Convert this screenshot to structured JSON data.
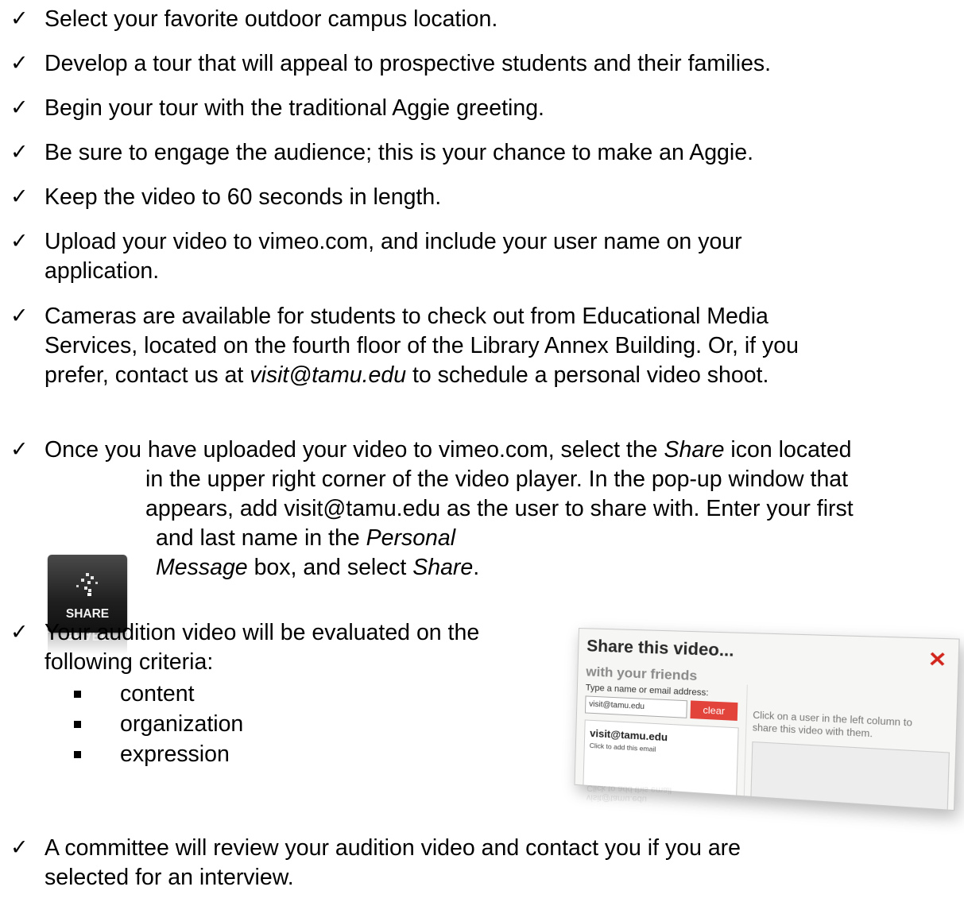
{
  "items": [
    {
      "text": "Select your favorite outdoor campus location."
    },
    {
      "text": "Develop a tour that will appeal to prospective students and their families."
    },
    {
      "text": "Begin your tour with the traditional Aggie greeting."
    },
    {
      "text": "Be sure to engage the audience; this is your chance to make an Aggie."
    },
    {
      "text": "Keep the video to 60 seconds in length."
    },
    {
      "line1": "Upload your video to vimeo.com, and include your user name on your",
      "line2": "application."
    },
    {
      "line1": "Cameras are available for students to check out from Educational Media",
      "line2": "Services, located on the fourth floor of the Library Annex Building.   Or, if you",
      "line3_pre": "prefer, contact us at ",
      "line3_em": "visit@tamu.edu",
      "line3_post": " to schedule a personal video shoot."
    },
    {
      "line1_pre": "Once you have uploaded your video to vimeo.com, select the ",
      "line1_em": "Share",
      "line1_post": " icon located",
      "line2": "in the upper right corner of the video player.  In the pop-up window that",
      "line3": "appears, add visit@tamu.edu as the user to share with.  Enter your first",
      "line4_pre": "and last name in the ",
      "line4_em": "Personal",
      "line5_em": "Message",
      "line5_mid": " box, and select ",
      "line5_em2": "Share",
      "line5_post": "."
    },
    {
      "line1": "Your audition video will be evaluated on the",
      "line2": "following criteria:",
      "criteria": [
        "content",
        "organization",
        "expression"
      ]
    },
    {
      "line1": "A committee will review your audition video and contact you if you are",
      "line2": "selected for an interview."
    }
  ],
  "share_icon": {
    "label": "SHARE",
    "icon": "share-icon"
  },
  "popup": {
    "title": "Share this video...",
    "subtitle": "with your friends",
    "input_label": "Type a name or email address:",
    "input_value": "visit@tamu.edu",
    "clear_label": "clear",
    "result_user": "visit@tamu.edu",
    "result_hint": "Click to add this email",
    "help_text": "Click on a user in the left column to share this video with them.",
    "close_icon": "close-icon"
  }
}
